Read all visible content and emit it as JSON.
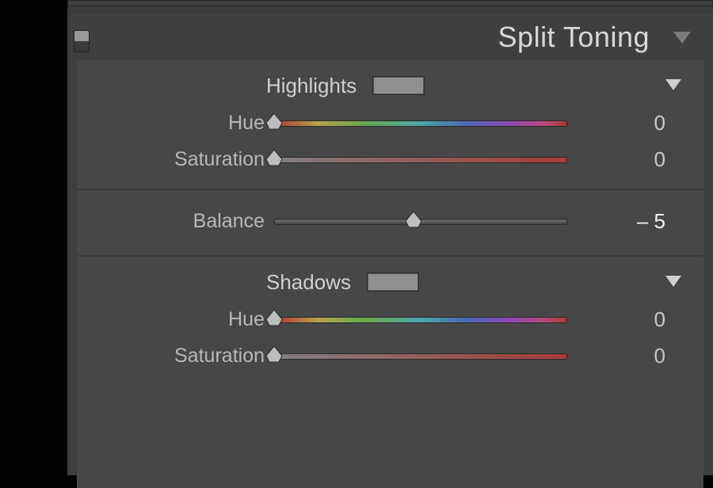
{
  "panel": {
    "title": "Split Toning"
  },
  "highlights": {
    "section_label": "Highlights",
    "hue": {
      "label": "Hue",
      "value": 0,
      "display": "0",
      "pos_pct": 0
    },
    "saturation": {
      "label": "Saturation",
      "value": 0,
      "display": "0",
      "pos_pct": 0
    }
  },
  "balance": {
    "label": "Balance",
    "value": -5,
    "display": "– 5",
    "pos_pct": 47.5
  },
  "shadows": {
    "section_label": "Shadows",
    "hue": {
      "label": "Hue",
      "value": 0,
      "display": "0",
      "pos_pct": 0
    },
    "saturation": {
      "label": "Saturation",
      "value": 0,
      "display": "0",
      "pos_pct": 0
    }
  }
}
